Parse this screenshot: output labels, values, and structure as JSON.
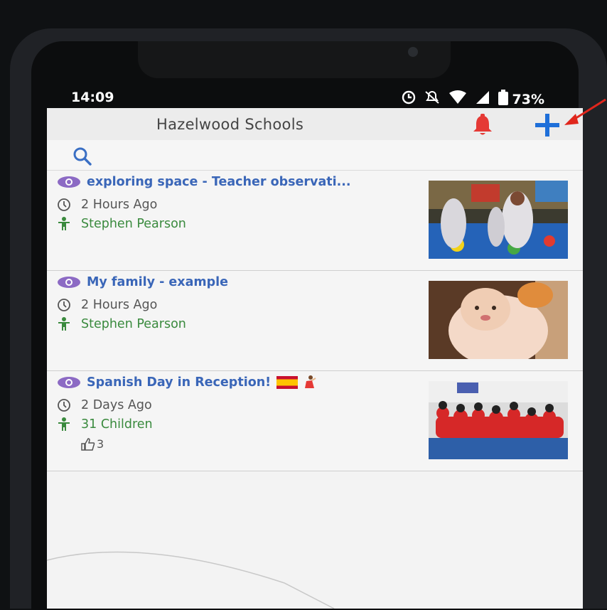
{
  "status_bar": {
    "time": "14:09",
    "battery": "73%"
  },
  "app": {
    "title": "Hazelwood Schools"
  },
  "icons": {
    "notifications": "bell-icon",
    "add": "plus-icon",
    "search": "search-icon"
  },
  "posts": [
    {
      "title": "exploring space - Teacher observati...",
      "time": "2 Hours Ago",
      "author": "Stephen Pearson"
    },
    {
      "title": "My family - example",
      "time": "2 Hours Ago",
      "author": "Stephen Pearson"
    },
    {
      "title": "Spanish Day in Reception!",
      "time": "2 Days Ago",
      "author": "31 Children",
      "likes": "3"
    }
  ],
  "colors": {
    "title_blue": "#3a66b8",
    "author_green": "#3a8a3e",
    "bell_red": "#e53935",
    "plus_blue": "#1e6fd9",
    "arrow_red": "#e0261c"
  }
}
